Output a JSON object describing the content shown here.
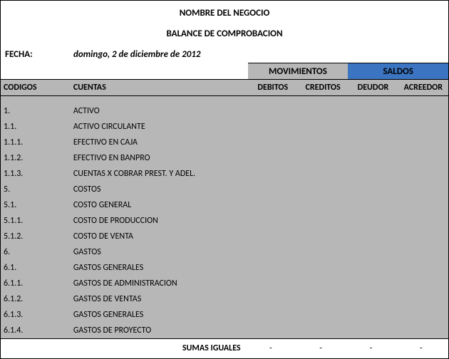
{
  "title": "NOMBRE DEL NEGOCIO",
  "subtitle": "BALANCE DE COMPROBACION",
  "date_label": "FECHA:",
  "date_value": "domingo, 2 de diciembre de 2012",
  "groups": {
    "movimientos": "MOVIMIENTOS",
    "saldos": "SALDOS"
  },
  "columns": {
    "codigos": "CODIGOS",
    "cuentas": "CUENTAS",
    "debitos": "DEBITOS",
    "creditos": "CREDITOS",
    "deudor": "DEUDOR",
    "acreedor": "ACREEDOR"
  },
  "rows": [
    {
      "code": "1.",
      "acct": "ACTIVO"
    },
    {
      "code": "1.1.",
      "acct": "ACTIVO CIRCULANTE"
    },
    {
      "code": "1.1.1.",
      "acct": "EFECTIVO EN CAJA"
    },
    {
      "code": "1.1.2.",
      "acct": "EFECTIVO EN BANPRO"
    },
    {
      "code": "1.1.3.",
      "acct": "CUENTAS X COBRAR PREST. Y ADEL."
    },
    {
      "code": "5.",
      "acct": "COSTOS"
    },
    {
      "code": "5.1.",
      "acct": "COSTO GENERAL"
    },
    {
      "code": "5.1.1.",
      "acct": "COSTO DE PRODUCCION"
    },
    {
      "code": "5.1.2.",
      "acct": "COSTO DE VENTA"
    },
    {
      "code": "6.",
      "acct": "GASTOS"
    },
    {
      "code": "6.1.",
      "acct": "GASTOS GENERALES"
    },
    {
      "code": "6.1.1.",
      "acct": "GASTOS DE ADMINISTRACION"
    },
    {
      "code": "6.1.2.",
      "acct": "GASTOS DE VENTAS"
    },
    {
      "code": "6.1.3.",
      "acct": "GASTOS GENERALES"
    },
    {
      "code": "6.1.4.",
      "acct": "GASTOS DE PROYECTO"
    }
  ],
  "footer": {
    "label": "SUMAS IGUALES",
    "debitos": "-",
    "creditos": "-",
    "deudor": "-",
    "acreedor": "-"
  }
}
